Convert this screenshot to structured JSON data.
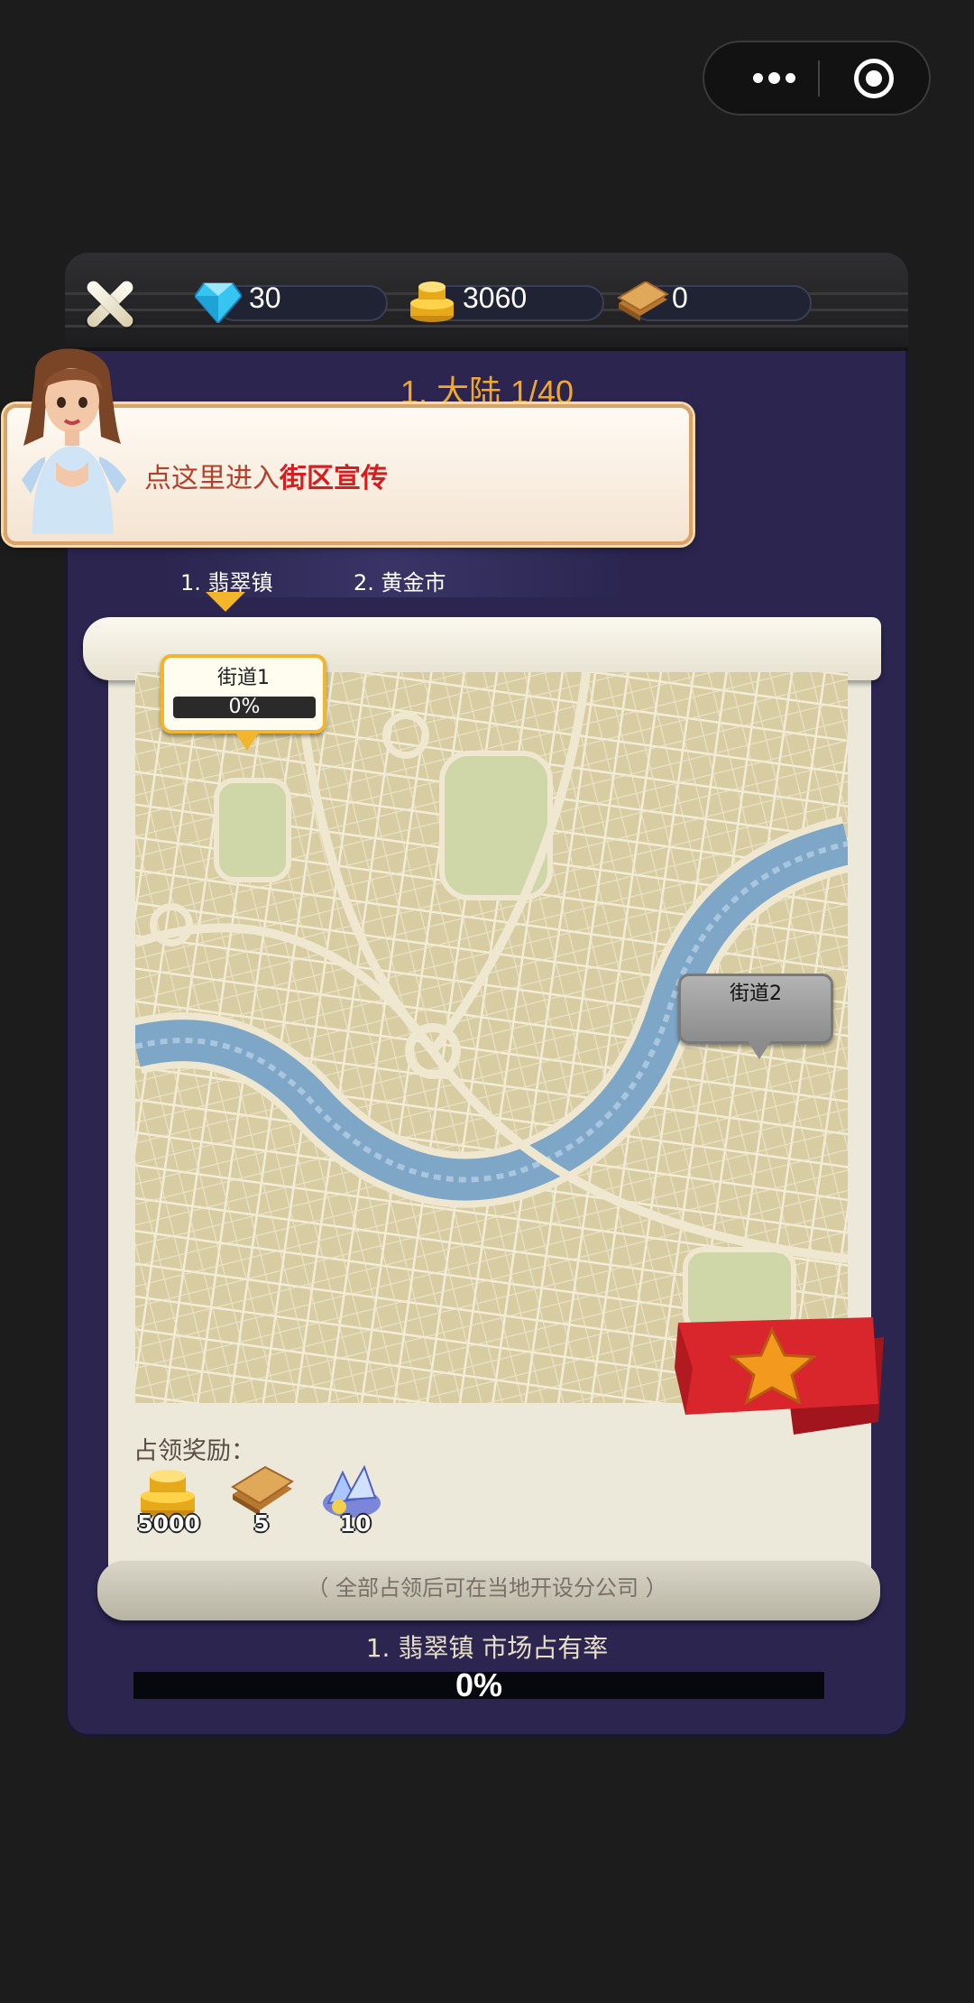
{
  "resources": {
    "diamonds": "30",
    "gold": "3060",
    "cash": "0"
  },
  "continent_title": "1. 大陆 1/40",
  "guide": {
    "prefix": "点这里进入",
    "highlight": "街区宣传"
  },
  "city_tabs": [
    {
      "label": "1. 翡翠镇",
      "selected": true
    },
    {
      "label": "2. 黄金市",
      "selected": false
    }
  ],
  "streets": [
    {
      "label": "街道1",
      "progress_label": "0%",
      "progress": 0,
      "unlocked": true
    },
    {
      "label": "街道2",
      "unlocked": false
    }
  ],
  "rewards": {
    "title": "占领奖励：",
    "items": [
      {
        "icon": "gold-coins-icon",
        "value": "5000"
      },
      {
        "icon": "cash-stack-icon",
        "value": "5"
      },
      {
        "icon": "crystal-ore-icon",
        "value": "10"
      }
    ]
  },
  "note": "（ 全部占领后可在当地开设分公司 ）",
  "market": {
    "label": "1. 翡翠镇 市场占有率",
    "percent_label": "0%",
    "percent": 0
  },
  "colors": {
    "panel": "#2b2550",
    "accent_gold": "#f2a82e",
    "guide_highlight": "#d61e1e"
  }
}
